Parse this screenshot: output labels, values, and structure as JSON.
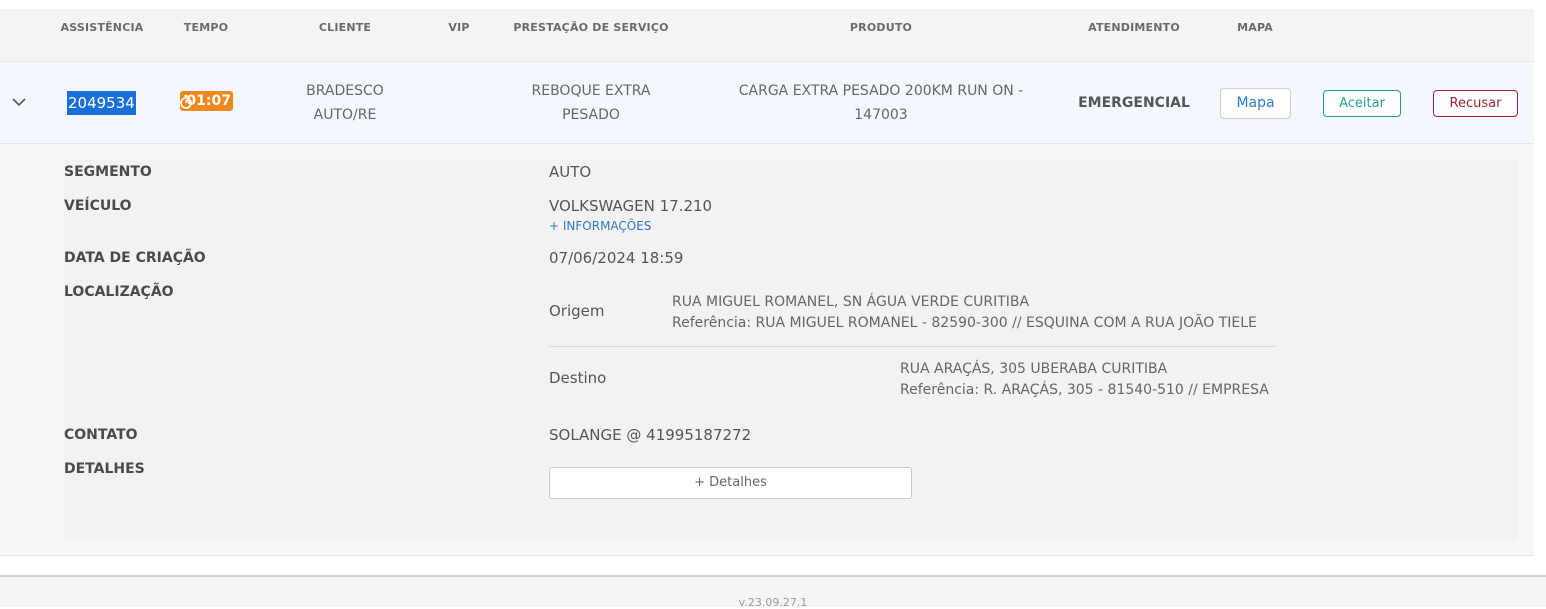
{
  "table": {
    "headers": {
      "assistencia": "ASSISTÊNCIA",
      "tempo": "TEMPO",
      "cliente": "CLIENTE",
      "vip": "VIP",
      "prestacao": "PRESTAÇÃO DE SERVIÇO",
      "produto": "PRODUTO",
      "atendimento": "ATENDIMENTO",
      "mapa": "MAPA"
    },
    "row": {
      "assistencia": "2049534",
      "tempo": "01:07",
      "cliente_line1": "BRADESCO",
      "cliente_line2": "AUTO/RE",
      "prestacao_line1": "REBOQUE EXTRA",
      "prestacao_line2": "PESADO",
      "produto_line1": "CARGA EXTRA PESADO 200KM RUN ON -",
      "produto_line2": "147003",
      "atendimento": "EMERGENCIAL",
      "mapa_button": "Mapa",
      "aceitar_button": "Aceitar",
      "recusar_button": "Recusar"
    }
  },
  "details": {
    "segmento_label": "SEGMENTO",
    "segmento_value": "AUTO",
    "veiculo_label": "VEÍCULO",
    "veiculo_value": "VOLKSWAGEN 17.210",
    "mais_informacoes": "+ INFORMAÇÕES",
    "data_label": "DATA DE CRIAÇÃO",
    "data_value": "07/06/2024 18:59",
    "localizacao_label": "LOCALIZAÇÃO",
    "origem_label": "Origem",
    "origem_endereco": "RUA MIGUEL ROMANEL, SN ÁGUA VERDE CURITIBA",
    "origem_referencia": "Referência: RUA MIGUEL ROMANEL - 82590-300 // ESQUINA COM A RUA JOÃO TIELE",
    "destino_label": "Destino",
    "destino_endereco": "RUA ARAÇÁS, 305 UBERABA CURITIBA",
    "destino_referencia": "Referência: R. ARAÇÁS, 305 - 81540-510 // EMPRESA",
    "contato_label": "CONTATO",
    "contato_value": "SOLANGE @ 41995187272",
    "detalhes_label": "DETALHES",
    "detalhes_button": "+ Detalhes"
  },
  "footer": {
    "version": "v.23.09.27.1"
  },
  "colors": {
    "selection": "#1b6fd8",
    "timer": "#f0871c",
    "accept": "#2a9d8f",
    "reject": "#9b2335",
    "link": "#2d7ac9"
  }
}
